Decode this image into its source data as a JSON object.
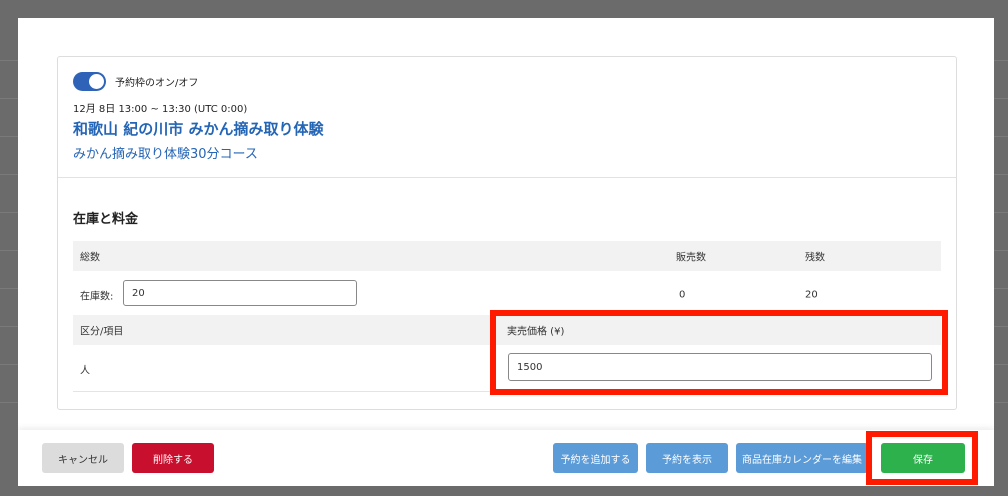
{
  "slot": {
    "toggle_label": "予約枠のオン/オフ",
    "toggle_on": true,
    "time": "12月 8日 13:00 ~ 13:30 (UTC 0:00)",
    "tour_title": "和歌山 紀の川市 みかん摘み取り体験",
    "course_name": "みかん摘み取り体験30分コース"
  },
  "inventory": {
    "section_title": "在庫と料金",
    "headers": {
      "total": "総数",
      "sold": "販売数",
      "remaining": "残数"
    },
    "stock_label": "在庫数:",
    "stock_value": "20",
    "sold_value": "0",
    "remaining_value": "20"
  },
  "pricing": {
    "category_header": "区分/項目",
    "price_header": "実売価格 (¥)",
    "rows": [
      {
        "category": "人",
        "price": "1500"
      }
    ]
  },
  "footer": {
    "cancel_label": "キャンセル",
    "delete_label": "削除する",
    "add_booking_label": "予約を追加する",
    "view_booking_label": "予約を表示",
    "edit_calendar_label": "商品在庫カレンダーを編集",
    "save_label": "保存"
  },
  "colors": {
    "accent": "#2565b5",
    "toggle": "#2f63b8",
    "delete": "#c8102e",
    "secondary_button": "#5b9bd8",
    "save": "#2db14d",
    "highlight": "#ff1a00"
  }
}
